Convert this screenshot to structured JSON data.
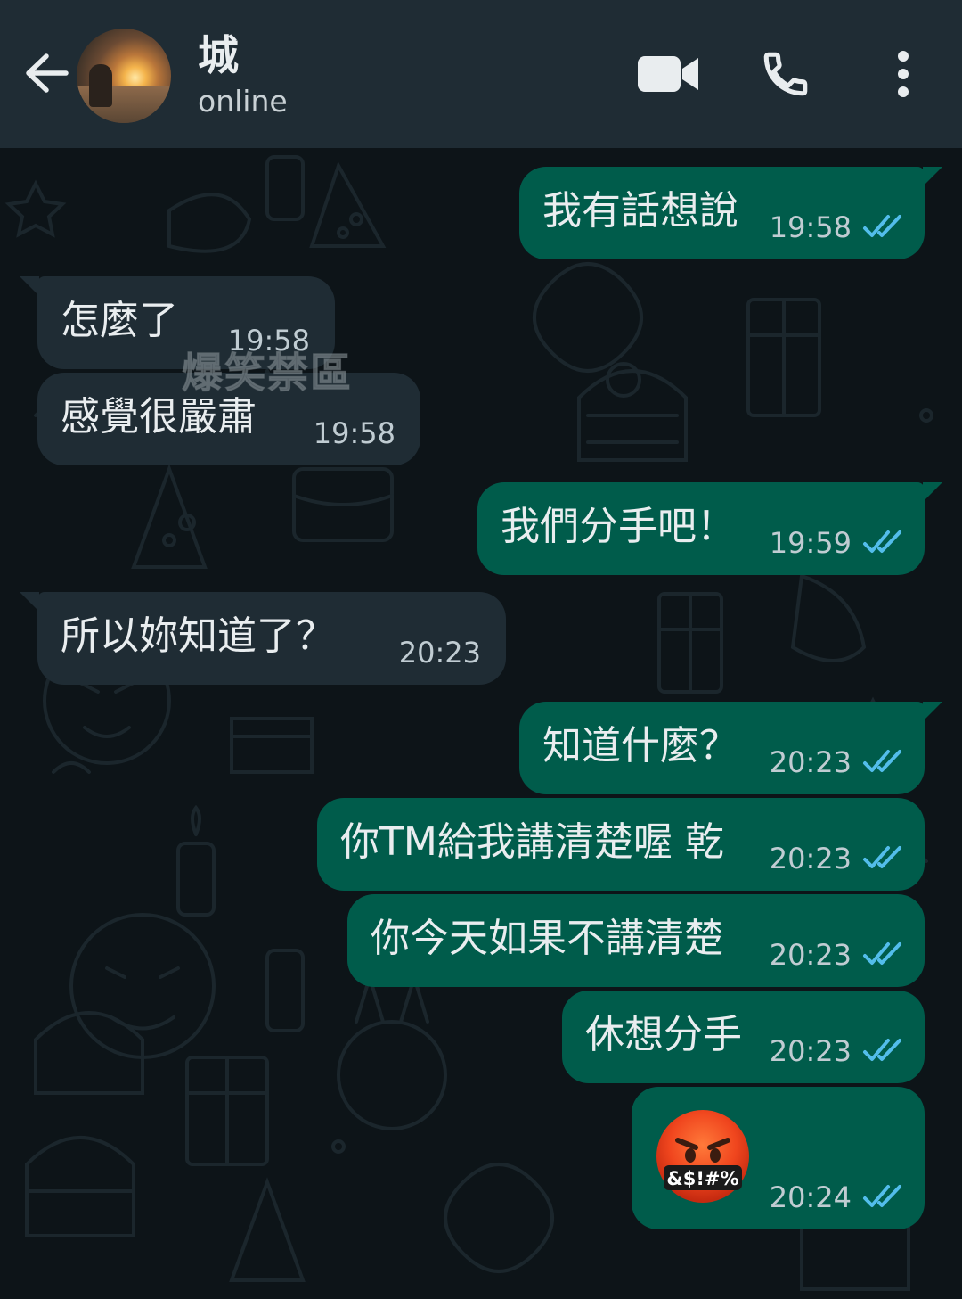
{
  "header": {
    "contact_name": "城",
    "status": "online"
  },
  "colors": {
    "header_bg": "#1f2c34",
    "chat_bg": "#0d1418",
    "outgoing_bubble": "#005c4b",
    "incoming_bubble": "#1f2c34",
    "read_tick": "#53bdeb"
  },
  "icons": [
    "back-arrow-icon",
    "video-call-icon",
    "phone-icon",
    "more-vert-icon",
    "double-check-icon",
    "face-with-symbols-on-mouth-emoji"
  ],
  "messages": [
    {
      "dir": "out",
      "text": "我有話想說",
      "time": "19:58",
      "read": true
    },
    {
      "dir": "in",
      "text": "怎麼了",
      "time": "19:58"
    },
    {
      "dir": "in",
      "text": "感覺很嚴肅",
      "time": "19:58"
    },
    {
      "dir": "out",
      "text": "我們分手吧！",
      "time": "19:59",
      "read": true
    },
    {
      "dir": "in",
      "text": "所以妳知道了？",
      "time": "20:23"
    },
    {
      "dir": "out",
      "text": "知道什麼？",
      "time": "20:23",
      "read": true
    },
    {
      "dir": "out",
      "text": "你TM給我講清楚喔 乾",
      "time": "20:23",
      "read": true
    },
    {
      "dir": "out",
      "text": "你今天如果不講清楚",
      "time": "20:23",
      "read": true
    },
    {
      "dir": "out",
      "text": "休想分手",
      "time": "20:23",
      "read": true
    },
    {
      "dir": "out",
      "emoji": "face-with-symbols-on-mouth",
      "emoji_text": "&$!#%",
      "time": "20:24",
      "read": true
    }
  ],
  "watermark": "爆笑禁區"
}
